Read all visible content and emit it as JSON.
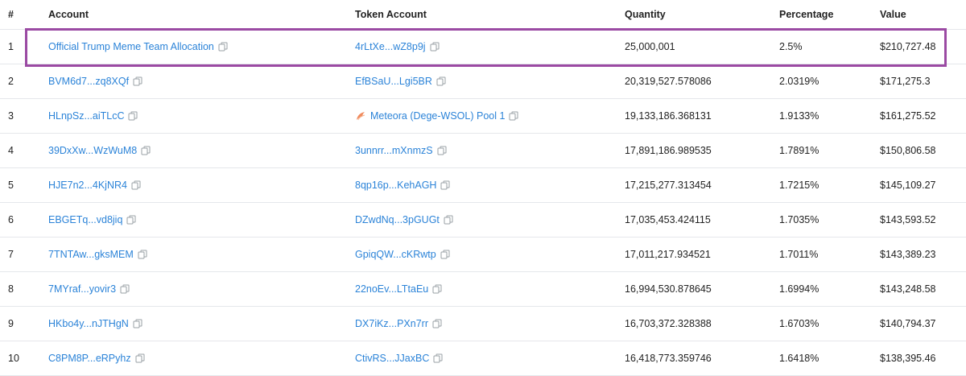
{
  "columns": {
    "num": "#",
    "account": "Account",
    "token_account": "Token Account",
    "quantity": "Quantity",
    "percentage": "Percentage",
    "value": "Value"
  },
  "colors": {
    "link": "#2b83d8",
    "highlight": "#9b4aa3",
    "pool_icon": "#f08a5d"
  },
  "icons": {
    "copy": "copy-icon",
    "pool": "meteora-pool-icon"
  },
  "rows": [
    {
      "num": "1",
      "account": "Official Trump Meme Team Allocation",
      "token_account": "4rLtXe...wZ8p9j",
      "quantity": "25,000,001",
      "percentage": "2.5%",
      "value": "$210,727.48",
      "highlighted": true
    },
    {
      "num": "2",
      "account": "BVM6d7...zq8XQf",
      "token_account": "EfBSaU...Lgi5BR",
      "quantity": "20,319,527.578086",
      "percentage": "2.0319%",
      "value": "$171,275.3"
    },
    {
      "num": "3",
      "account": "HLnpSz...aiTLcC",
      "token_account": "Meteora (Dege-WSOL) Pool 1",
      "token_has_icon": true,
      "quantity": "19,133,186.368131",
      "percentage": "1.9133%",
      "value": "$161,275.52"
    },
    {
      "num": "4",
      "account": "39DxXw...WzWuM8",
      "token_account": "3unnrr...mXnmzS",
      "quantity": "17,891,186.989535",
      "percentage": "1.7891%",
      "value": "$150,806.58"
    },
    {
      "num": "5",
      "account": "HJE7n2...4KjNR4",
      "token_account": "8qp16p...KehAGH",
      "quantity": "17,215,277.313454",
      "percentage": "1.7215%",
      "value": "$145,109.27"
    },
    {
      "num": "6",
      "account": "EBGETq...vd8jiq",
      "token_account": "DZwdNq...3pGUGt",
      "quantity": "17,035,453.424115",
      "percentage": "1.7035%",
      "value": "$143,593.52"
    },
    {
      "num": "7",
      "account": "7TNTAw...gksMEM",
      "token_account": "GpiqQW...cKRwtp",
      "quantity": "17,011,217.934521",
      "percentage": "1.7011%",
      "value": "$143,389.23"
    },
    {
      "num": "8",
      "account": "7MYraf...yovir3",
      "token_account": "22noEv...LTtaEu",
      "quantity": "16,994,530.878645",
      "percentage": "1.6994%",
      "value": "$143,248.58"
    },
    {
      "num": "9",
      "account": "HKbo4y...nJTHgN",
      "token_account": "DX7iKz...PXn7rr",
      "quantity": "16,703,372.328388",
      "percentage": "1.6703%",
      "value": "$140,794.37"
    },
    {
      "num": "10",
      "account": "C8PM8P...eRPyhz",
      "token_account": "CtivRS...JJaxBC",
      "quantity": "16,418,773.359746",
      "percentage": "1.6418%",
      "value": "$138,395.46"
    }
  ]
}
